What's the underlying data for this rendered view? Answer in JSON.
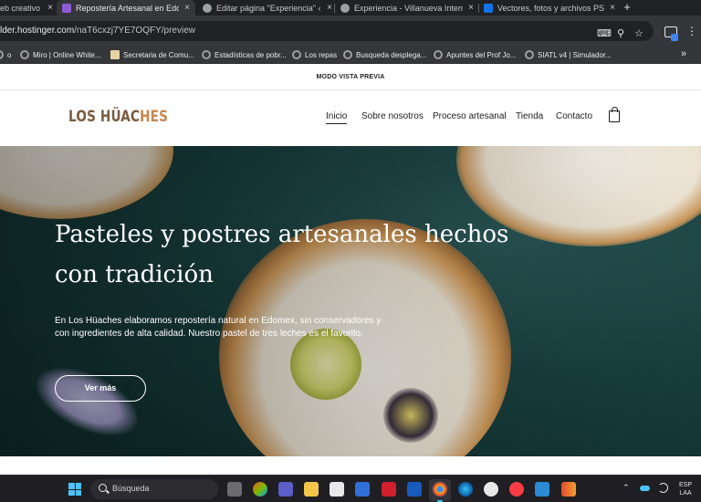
{
  "browser": {
    "tabs": [
      {
        "title": "eb creativo",
        "favicon_color": "#35363a"
      },
      {
        "title": "Repostería Artesanal en Edomex",
        "favicon_color": "#8e5bd6"
      },
      {
        "title": "Editar página \"Experiencia\" ‹ Villanueva",
        "favicon_color": "#9aa0a6"
      },
      {
        "title": "Experiencia - Villanueva Internacional",
        "favicon_color": "#9aa0a6"
      },
      {
        "title": "Vectores, fotos y archivos PSD",
        "favicon_color": "#1273eb"
      }
    ],
    "new_tab_label": "+",
    "url_host": "lder.hostinger.com",
    "url_path": "/naT6cxzj7YE7OQFY/preview",
    "bookmarks": [
      {
        "label": "o",
        "icon": "globe-icon"
      },
      {
        "label": "Miro | Online White...",
        "icon": "globe-icon"
      },
      {
        "label": "Secretaria de Comu...",
        "icon": "doc-icon"
      },
      {
        "label": "Estadísticas de pobr...",
        "icon": "globe-icon"
      },
      {
        "label": "Los repas",
        "icon": "globe-icon"
      },
      {
        "label": "Busqueda desplega...",
        "icon": "globe-icon"
      },
      {
        "label": "Apuntes del Prof Jo...",
        "icon": "globe-icon"
      },
      {
        "label": "SIATL v4 | Simulador...",
        "icon": "globe-icon"
      }
    ],
    "bookmarks_more": "»"
  },
  "site": {
    "preview_label": "MODO VISTA PREVIA",
    "logo_part1": "LOS HÜAC",
    "logo_part2": "HES",
    "nav": [
      "Inicio",
      "Sobre nosotros",
      "Proceso artesanal",
      "Tienda",
      "Contacto"
    ],
    "hero": {
      "title": "Pasteles y postres artesanales hechos con tradición",
      "text": "En Los Hüaches elaboramos repostería natural en Edomex, sin conservadores y con ingredientes de alta calidad. Nuestro pastel de tres leches es el favorito.",
      "button": "Ver más"
    },
    "colors": {
      "logo_dark": "#7a5a3e",
      "logo_accent": "#c8864f",
      "hero_bg": "#18403f"
    }
  },
  "taskbar": {
    "search_placeholder": "Búsqueda",
    "lang_line1": "ESP",
    "lang_line2": "LAA"
  }
}
